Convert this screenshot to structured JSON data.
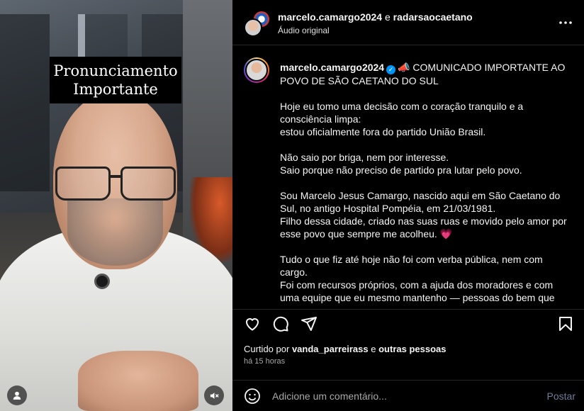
{
  "video": {
    "caption_line1": "Pronunciamento",
    "caption_line2": "Importante",
    "user_icon": "user-icon",
    "mute_icon": "speaker-muted-icon"
  },
  "header": {
    "user1": "marcelo.camargo2024",
    "conjunction": "e",
    "user2": "radarsaocaetano",
    "audio": "Áudio original",
    "more_icon": "more-horizontal-icon"
  },
  "post": {
    "username": "marcelo.camargo2024",
    "headline": "COMUNICADO IMPORTANTE AO POVO DE SÃO CAETANO DO SUL",
    "headline_emoji": "📣",
    "paragraphs": [
      [
        "Hoje eu tomo uma decisão com o coração tranquilo e a consciência limpa:",
        "estou oficialmente fora do partido União Brasil."
      ],
      [
        "Não saio por briga, nem por interesse.",
        "Saio porque não preciso de partido pra lutar pelo povo."
      ],
      [
        "Sou Marcelo Jesus Camargo, nascido aqui em São Caetano do Sul, no antigo Hospital Pompéia, em 21/03/1981.",
        "Filho dessa cidade, criado nas suas ruas e movido pelo amor por esse povo que sempre me acolheu. 💗"
      ],
      [
        "Tudo o que fiz até hoje não foi com verba pública, nem com cargo.",
        "Foi com recursos próprios, com a ajuda dos moradores e com uma equipe que eu mesmo mantenho — pessoas do bem que"
      ]
    ]
  },
  "actions": {
    "like_icon": "heart-icon",
    "comment_icon": "comment-icon",
    "share_icon": "send-icon",
    "save_icon": "bookmark-icon"
  },
  "likes": {
    "prefix": "Curtido por",
    "user": "vanda_parreirass",
    "middle": "e",
    "others": "outras pessoas"
  },
  "time": "há 15 horas",
  "comment": {
    "placeholder": "Adicione um comentário...",
    "post_label": "Postar",
    "emoji_icon": "emoji-icon"
  },
  "colors": {
    "background": "#000000",
    "text": "#f5f5f5",
    "muted": "#a8a8a8",
    "verified": "#0095f6",
    "post_button": "#6f7d99"
  }
}
